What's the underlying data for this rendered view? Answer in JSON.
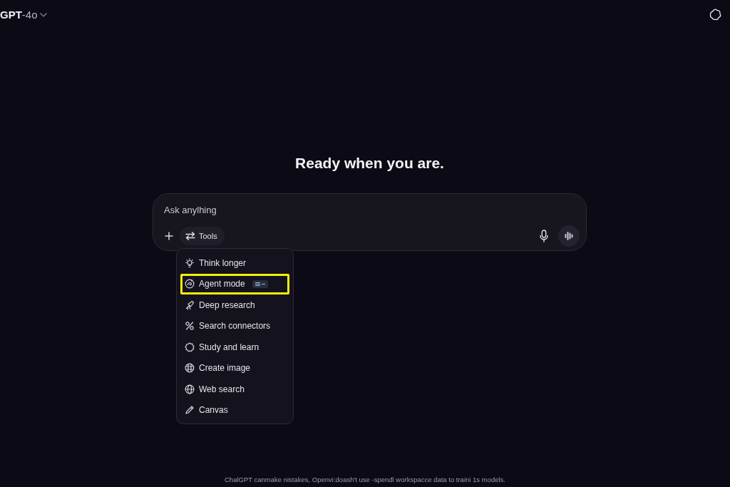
{
  "header": {
    "model_name": "GPT",
    "model_version": "-4o"
  },
  "heading": "Ready when you are.",
  "composer": {
    "placeholder": "Ask anylhing",
    "tools_label": "Tools"
  },
  "tools_menu": {
    "items": [
      {
        "label": "Think longer",
        "kind": "bulb",
        "highlighted": false,
        "badge": false
      },
      {
        "label": "Agent mode",
        "kind": "agent",
        "highlighted": true,
        "badge": true
      },
      {
        "label": "Deep research",
        "kind": "telescope",
        "highlighted": false,
        "badge": false
      },
      {
        "label": "Search connectors",
        "kind": "connectors",
        "highlighted": false,
        "badge": false
      },
      {
        "label": "Study and learn",
        "kind": "study",
        "highlighted": false,
        "badge": false
      },
      {
        "label": "Create image",
        "kind": "image",
        "highlighted": false,
        "badge": false
      },
      {
        "label": "Web search",
        "kind": "globe",
        "highlighted": false,
        "badge": false
      },
      {
        "label": "Canvas",
        "kind": "pencil",
        "highlighted": false,
        "badge": false
      }
    ]
  },
  "footer": "ChalGPT canmake nistakes, Openvi:doash't use -spendl workspacce data to traini 1s models."
}
